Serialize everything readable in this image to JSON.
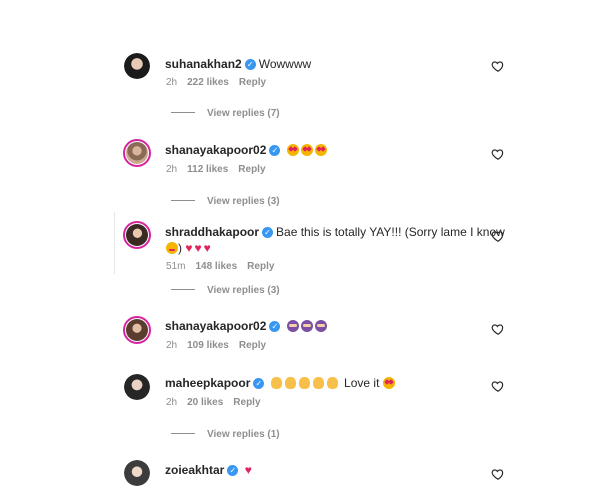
{
  "comments": [
    {
      "username": "suhanakhan2",
      "text": "Wowwww",
      "time": "2h",
      "likes": "222 likes",
      "reply": "Reply",
      "view_replies": "View replies (7)",
      "emojis": []
    },
    {
      "username": "shanayakapoor02",
      "text": "",
      "time": "2h",
      "likes": "112 likes",
      "reply": "Reply",
      "view_replies": "View replies (3)",
      "emojis": [
        "heart-eyes",
        "heart-eyes",
        "heart-eyes"
      ]
    },
    {
      "username": "shraddhakapoor",
      "text": "Bae this is totally YAY!!! (Sorry lame I know",
      "text2_suffix": ")",
      "time": "51m",
      "likes": "148 likes",
      "reply": "Reply",
      "view_replies": "View replies (3)",
      "emojis": [
        "smiling-face",
        "red-heart",
        "red-heart",
        "red-heart"
      ]
    },
    {
      "username": "shanayakapoor02",
      "text": "",
      "time": "2h",
      "likes": "109 likes",
      "reply": "Reply",
      "view_replies": "",
      "emojis": [
        "ninja",
        "ninja",
        "ninja"
      ]
    },
    {
      "username": "maheepkapoor",
      "text": "Love it",
      "time": "2h",
      "likes": "20 likes",
      "reply": "Reply",
      "view_replies": "View replies (1)",
      "emojis": [
        "clap",
        "clap",
        "clap",
        "clap",
        "clap",
        "heart-eyes"
      ]
    },
    {
      "username": "zoieakhtar",
      "text": "",
      "time": "",
      "likes": "",
      "reply": "",
      "view_replies": "",
      "emojis": [
        "red-heart"
      ]
    }
  ],
  "icons": {
    "verified": "verified-badge-icon",
    "like": "heart-outline-icon"
  },
  "colors": {
    "verified": "#3897f0",
    "muted": "#8e8e8e",
    "story_ring": "#d6249f"
  }
}
